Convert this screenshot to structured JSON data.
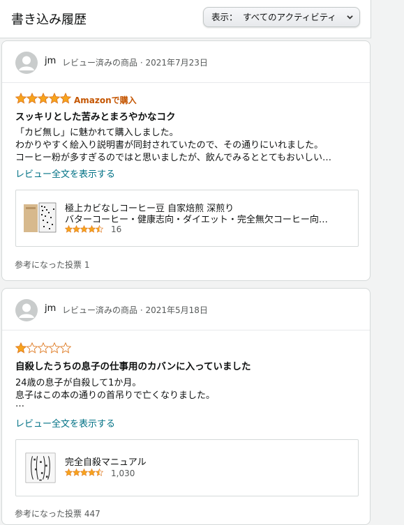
{
  "header": {
    "title": "書き込み履歴",
    "filter_label": "表示：",
    "filter_value": "すべてのアクティビティ"
  },
  "reviews": [
    {
      "user": "jm",
      "meta": "レビュー済みの商品 · 2021年7月23日",
      "rating": 5,
      "badge": "Amazonで購入",
      "title": "スッキリとした苦みとまろやかなコク",
      "body": [
        "「カビ無し」に魅かれて購入しました。",
        "わかりやすく絵入り説明書が同封されていたので、その通りにいれました。",
        "コーヒー粉が多すぎるのではと思いましたが、飲んでみるととてもおいしい…"
      ],
      "more_link": "レビュー全文を表示する",
      "product": {
        "name_line1": "極上カビなしコーヒー豆 自家焙煎 深煎り",
        "name_line2": "バターコーヒー・健康志向・ダイエット・完全無欠コーヒー向…",
        "rating": 4.5,
        "rating_count": "16"
      },
      "helpful": "参考になった投票 1"
    },
    {
      "user": "jm",
      "meta": "レビュー済みの商品 · 2021年5月18日",
      "rating": 1,
      "badge": "",
      "title": "自殺したうちの息子の仕事用のカバンに入っていました",
      "body": [
        "24歳の息子が自殺して1か月。",
        "息子はこの本の通りの首吊りで亡くなりました。",
        "…"
      ],
      "more_link": "レビュー全文を表示する",
      "product": {
        "name_line1": "完全自殺マニュアル",
        "name_line2": "",
        "rating": 4.5,
        "rating_count": "1,030"
      },
      "helpful": "参考になった投票 447"
    }
  ],
  "colors": {
    "star": "#f7a41d",
    "badge": "#c45500",
    "link": "#007185"
  }
}
